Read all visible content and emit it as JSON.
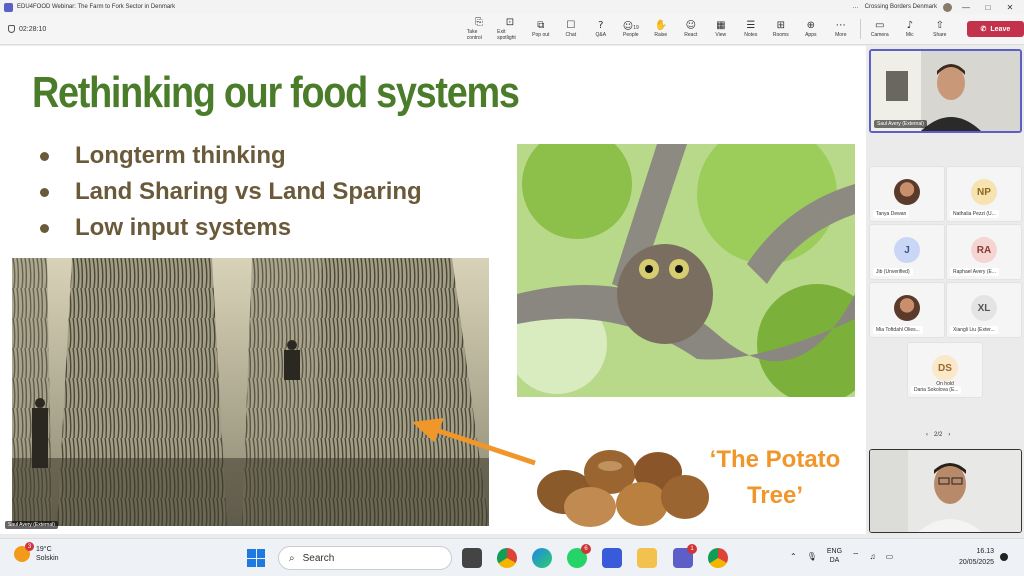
{
  "window": {
    "title": "EDU4FOOD Webinar: The Farm to Fork Sector in Denmark",
    "org": "Crossing Borders Denmark",
    "controls": [
      "…",
      "—",
      "□",
      "✕"
    ]
  },
  "toolbar": {
    "timer": "02:28:10",
    "tools": [
      {
        "label": "Take control",
        "icon": "take-control-icon",
        "glyph": "⎘"
      },
      {
        "label": "Exit spotlight",
        "icon": "exit-spotlight-icon",
        "glyph": "⊡"
      },
      {
        "label": "Pop out",
        "icon": "pop-out-icon",
        "glyph": "⧉"
      },
      {
        "label": "Chat",
        "icon": "chat-icon",
        "glyph": "☐"
      },
      {
        "label": "Q&A",
        "icon": "qa-icon",
        "glyph": "?"
      },
      {
        "label": "People",
        "icon": "people-icon",
        "glyph": "☺",
        "count": "19"
      },
      {
        "label": "Raise",
        "icon": "raise-hand-icon",
        "glyph": "✋"
      },
      {
        "label": "React",
        "icon": "react-icon",
        "glyph": "☺"
      },
      {
        "label": "View",
        "icon": "view-icon",
        "glyph": "▦"
      },
      {
        "label": "Notes",
        "icon": "notes-icon",
        "glyph": "☰"
      },
      {
        "label": "Rooms",
        "icon": "rooms-icon",
        "glyph": "⊞"
      },
      {
        "label": "Apps",
        "icon": "apps-icon",
        "glyph": "⊕"
      },
      {
        "label": "More",
        "icon": "more-icon",
        "glyph": "⋯"
      }
    ],
    "media": [
      {
        "label": "Camera",
        "icon": "camera-icon",
        "glyph": "▭"
      },
      {
        "label": "Mic",
        "icon": "mic-icon",
        "glyph": "♪"
      },
      {
        "label": "Share",
        "icon": "share-icon",
        "glyph": "⇧"
      }
    ],
    "leave_label": "Leave"
  },
  "slide": {
    "title": "Rethinking our food systems",
    "bullets": [
      "Longterm thinking",
      "Land Sharing vs Land Sparing",
      "Low input systems"
    ],
    "potato_line1": "‘The Potato",
    "potato_line2": "Tree’",
    "presenter_tag": "Saul Avery (External)",
    "colors": {
      "title": "#4a7c2a",
      "bullets": "#6b5a3a",
      "accent": "#f0962a"
    }
  },
  "panel": {
    "main_video_name": "Saul Avery (External)",
    "participants": [
      {
        "initials": "",
        "name": "Tanya Dewan",
        "avatar_type": "photo"
      },
      {
        "initials": "NP",
        "name": "Nathalia Pezzi (U...",
        "color": "#f7e3b1",
        "text_color": "#8a6a1a"
      },
      {
        "initials": "J",
        "name": "Jib (Unverified)",
        "color": "#c9d6f5",
        "text_color": "#3a4f8a"
      },
      {
        "initials": "RA",
        "name": "Raphael Avery (E...",
        "color": "#f5d5d2",
        "text_color": "#8a3a32"
      },
      {
        "initials": "",
        "name": "Mia Toftdahl Olies...",
        "avatar_type": "photo"
      },
      {
        "initials": "XL",
        "name": "Xiangli Liu (Exter...",
        "color": "#e4e4e4",
        "text_color": "#555"
      },
      {
        "initials": "DS",
        "name": "Daria Sokolova (E...",
        "color": "#fbe7c9",
        "text_color": "#9a6a2a",
        "status": "On hold"
      }
    ],
    "pager": "2/2"
  },
  "taskbar": {
    "temperature": "19°C",
    "location": "Solskin",
    "weather_badge": "3",
    "search_placeholder": "Search",
    "whatsapp_badge": "6",
    "teams_badge": "1",
    "lang_top": "ENG",
    "lang_bottom": "DA",
    "time": "16.13",
    "date": "20/05/2025"
  }
}
